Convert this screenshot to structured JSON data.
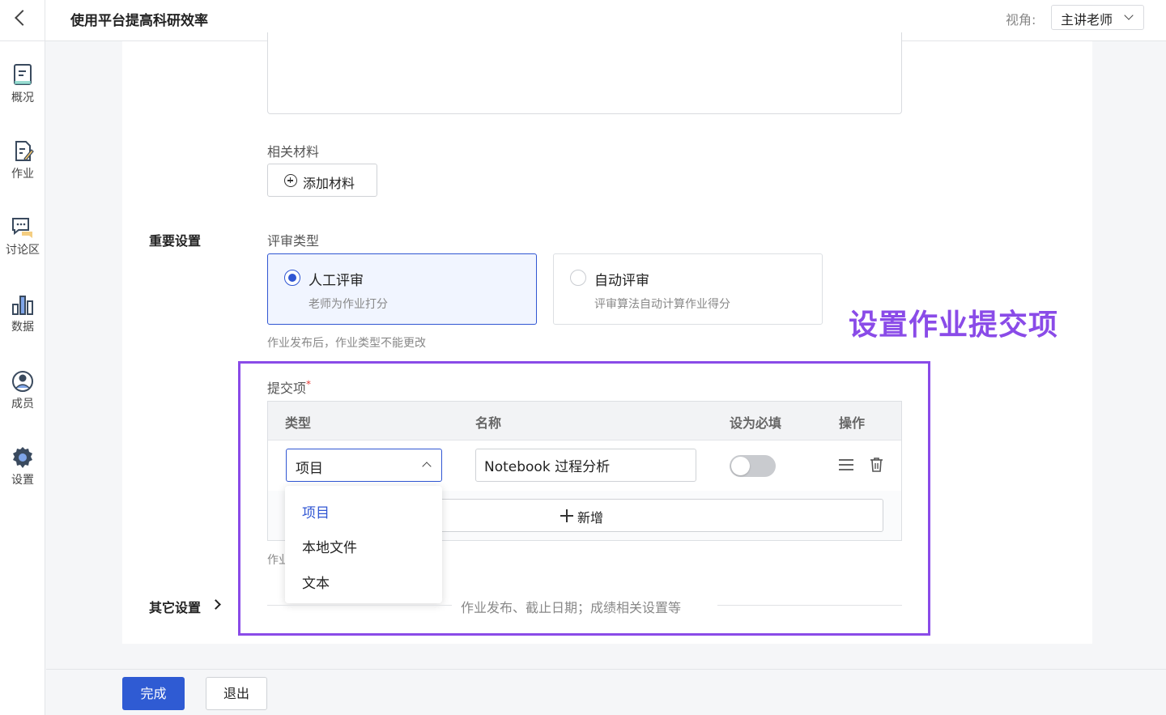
{
  "header": {
    "title": "使用平台提高科研效率",
    "view_label": "视角:",
    "view_value": "主讲老师"
  },
  "sidebar": {
    "items": [
      {
        "label": "概况",
        "icon": "overview-doc-icon"
      },
      {
        "label": "作业",
        "icon": "assignment-edit-icon"
      },
      {
        "label": "讨论区",
        "icon": "discussion-chat-icon"
      },
      {
        "label": "数据",
        "icon": "data-bar-chart-icon"
      },
      {
        "label": "成员",
        "icon": "member-user-icon"
      },
      {
        "label": "设置",
        "icon": "settings-gear-icon"
      }
    ]
  },
  "materials": {
    "label": "相关材料",
    "add_button": "添加材料"
  },
  "important": {
    "section_title": "重要设置",
    "review_label": "评审类型",
    "options": [
      {
        "title": "人工评审",
        "desc": "老师为作业打分",
        "selected": true
      },
      {
        "title": "自动评审",
        "desc": "评审算法自动计算作业得分",
        "selected": false
      }
    ],
    "hint": "作业发布后，作业类型不能更改"
  },
  "annotation": {
    "text": "设置作业提交项",
    "color": "#8a4be8"
  },
  "submission": {
    "label": "提交项",
    "required_mark": "*",
    "columns": [
      "类型",
      "名称",
      "设为必填",
      "操作"
    ],
    "row": {
      "type": "项目",
      "name": "Notebook 过程分析",
      "required": false
    },
    "add_row_button": "新增",
    "hint_partial": "作业",
    "dropdown_options": [
      {
        "label": "项目",
        "active": true
      },
      {
        "label": "本地文件",
        "active": false
      },
      {
        "label": "文本",
        "active": false
      }
    ]
  },
  "other": {
    "title": "其它设置",
    "desc": "作业发布、截止日期；成绩相关设置等"
  },
  "footer": {
    "done": "完成",
    "exit": "退出"
  },
  "colors": {
    "primary": "#2f5bd3",
    "accent_selected": "#3056d3"
  }
}
